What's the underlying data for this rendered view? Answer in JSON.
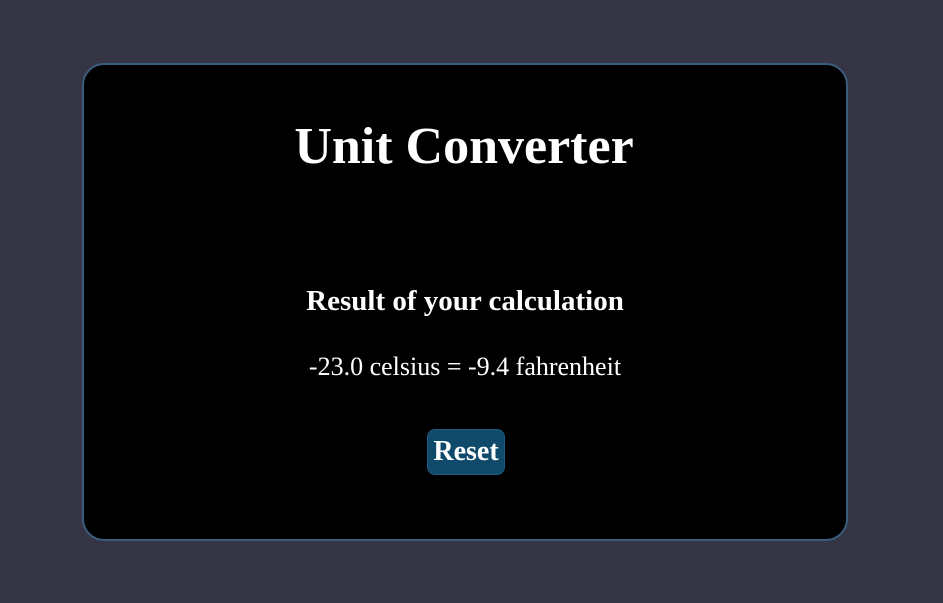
{
  "app": {
    "title": "Unit Converter"
  },
  "result": {
    "heading": "Result of your calculation",
    "text": "-23.0 celsius = -9.4 fahrenheit"
  },
  "actions": {
    "reset_label": "Reset"
  },
  "colors": {
    "page_background": "#363546",
    "card_background": "#000000",
    "card_border": "#3a5c7e",
    "button_background": "#0f4a6b",
    "text": "#ffffff"
  }
}
